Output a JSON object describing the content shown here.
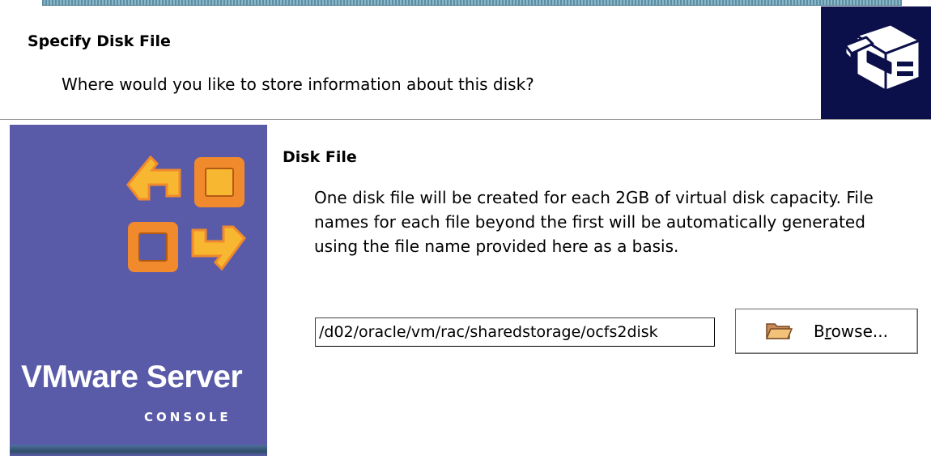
{
  "header": {
    "title": "Specify Disk File",
    "subtitle": "Where would you like to store information about this disk?",
    "icon": "disk-drive-icon"
  },
  "sidebar": {
    "brand_name": "VMware Server",
    "brand_sub": "CONSOLE",
    "logo": "vmware-logo-icon"
  },
  "section": {
    "title": "Disk File",
    "description": "One disk file will be created for each 2GB of virtual disk capacity. File names for each file beyond the first will be automatically generated using the file name provided here as a basis."
  },
  "file_path": {
    "value": "/d02/oracle/vm/rac/sharedstorage/ocfs2disk"
  },
  "browse": {
    "label_prefix": "B",
    "label_mnemonic": "r",
    "label_suffix": "owse...",
    "icon": "folder-icon"
  },
  "colors": {
    "sidebar_bg": "#5a5ba8",
    "header_icon_bg": "#0b0f4a",
    "logo_orange": "#f08a2c",
    "logo_yellow": "#f7b731"
  }
}
